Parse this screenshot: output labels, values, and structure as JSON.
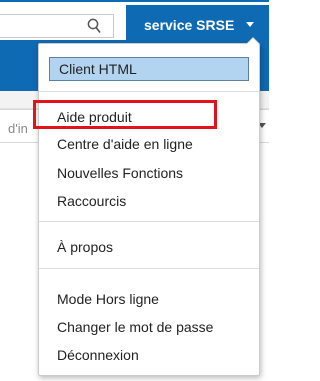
{
  "header": {
    "user_name": "service SRSE",
    "search_icon": "search-icon",
    "caret_icon": "chevron-down-icon",
    "brand_color": "#0f6ab4"
  },
  "background": {
    "field_hint": "d'in"
  },
  "menu": {
    "client_item": "Client HTML",
    "items_group1": [
      "Aide produit",
      "Centre d'aide en ligne",
      "Nouvelles Fonctions",
      "Raccourcis"
    ],
    "items_group2": [
      "À propos"
    ],
    "items_group3": [
      "Mode Hors ligne",
      "Changer le mot de passe",
      "Déconnexion"
    ],
    "selected_color": "#b3d4f0",
    "highlight_color": "#e3131b"
  }
}
